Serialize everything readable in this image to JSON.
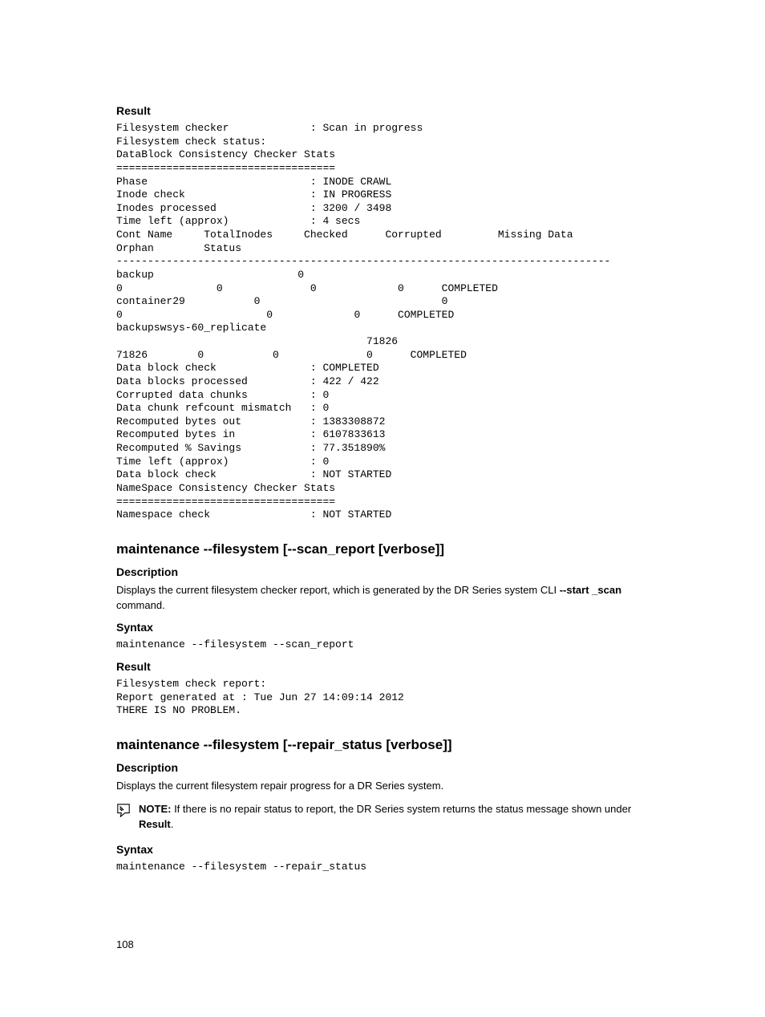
{
  "sec1": {
    "heading": "Result",
    "pre": "Filesystem checker             : Scan in progress\nFilesystem check status:\nDataBlock Consistency Checker Stats\n===================================\nPhase                          : INODE CRAWL\nInode check                    : IN PROGRESS\nInodes processed               : 3200 / 3498\nTime left (approx)             : 4 secs\nCont Name     TotalInodes     Checked      Corrupted         Missing Data     \nOrphan        Status\n-------------------------------------------------------------------------------\nbackup                       0              \n0               0              0             0      COMPLETED\ncontainer29           0                             0\n0                       0             0      COMPLETED\nbackupswsys-60_replicate                                                \n                                        71826                \n71826        0           0              0      COMPLETED\nData block check               : COMPLETED\nData blocks processed          : 422 / 422\nCorrupted data chunks          : 0\nData chunk refcount mismatch   : 0\nRecomputed bytes out           : 1383308872\nRecomputed bytes in            : 6107833613\nRecomputed % Savings           : 77.351890%\nTime left (approx)             : 0\nData block check               : NOT STARTED\nNameSpace Consistency Checker Stats\n===================================\nNamespace check                : NOT STARTED"
  },
  "sec2": {
    "heading": "maintenance --filesystem [--scan_report [verbose]]",
    "desc_heading": "Description",
    "desc_text_pre": "Displays the current filesystem checker report, which is generated by the DR Series system CLI ",
    "desc_bold": "--start _scan",
    "desc_text_post": " command.",
    "syntax_heading": "Syntax",
    "syntax_pre": "maintenance --filesystem --scan_report",
    "result_heading": "Result",
    "result_pre": "Filesystem check report:\nReport generated at : Tue Jun 27 14:09:14 2012\nTHERE IS NO PROBLEM."
  },
  "sec3": {
    "heading": "maintenance --filesystem [--repair_status [verbose]]",
    "desc_heading": "Description",
    "desc_text": "Displays the current filesystem repair progress for a DR Series system.",
    "note_label": "NOTE: ",
    "note_text_pre": "If there is no repair status to report, the DR Series system returns the status message shown under ",
    "note_bold": "Result",
    "note_text_post": ".",
    "syntax_heading": "Syntax",
    "syntax_pre": "maintenance --filesystem --repair_status"
  },
  "page_number": "108"
}
